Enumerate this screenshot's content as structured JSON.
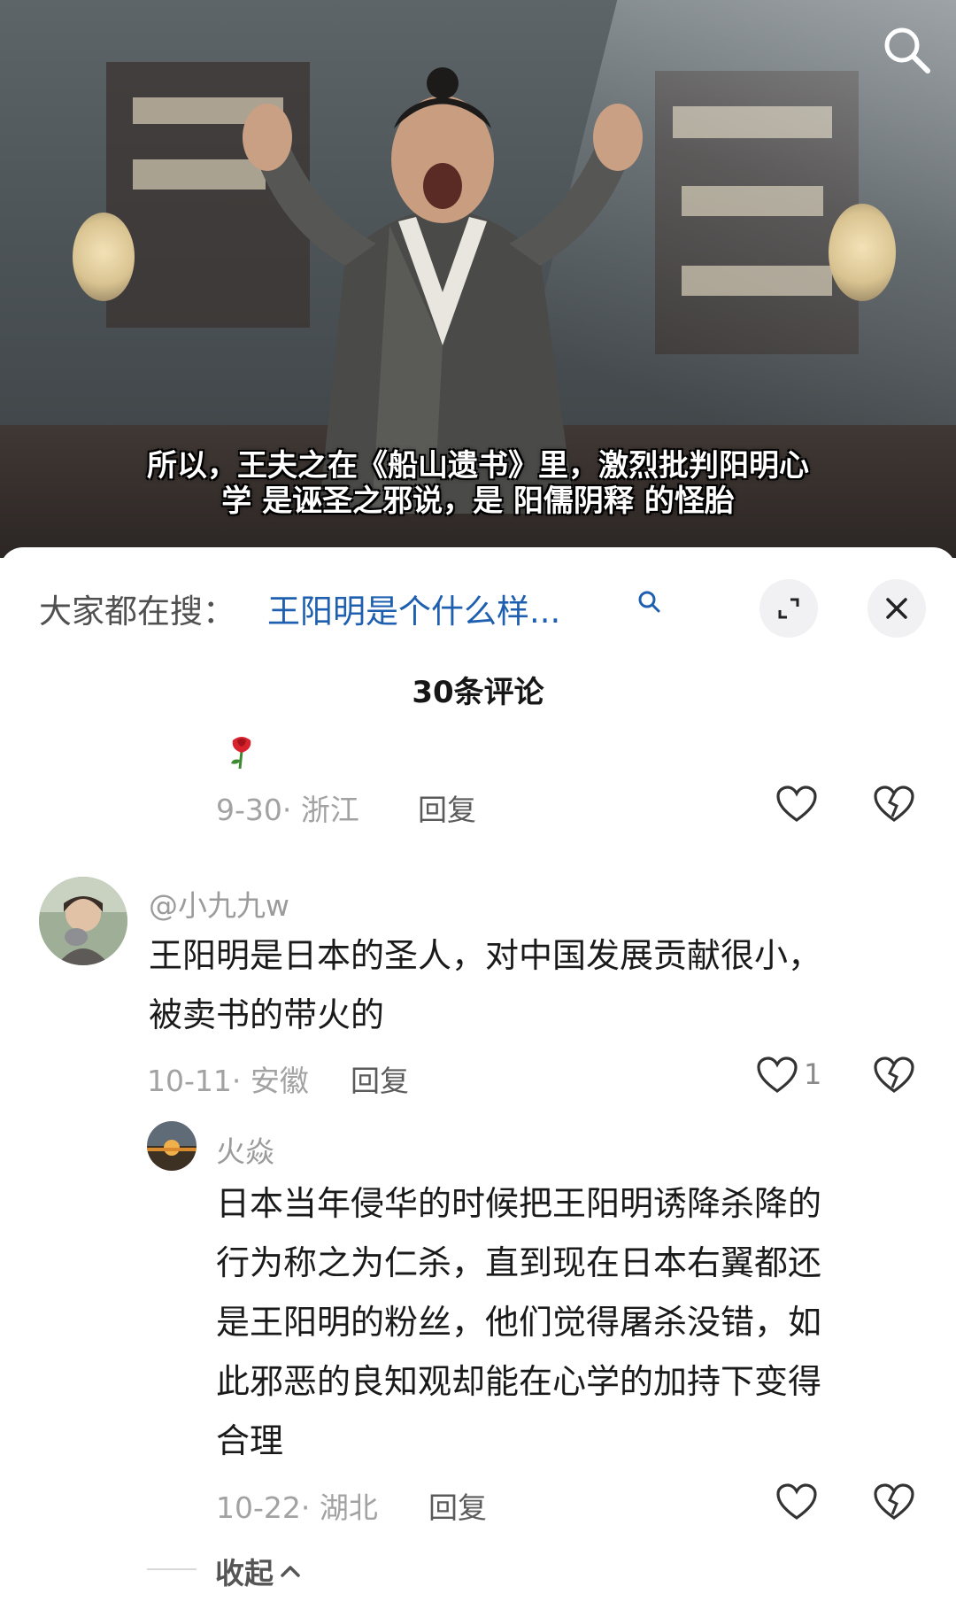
{
  "video": {
    "subtitle_line1": "所以，王夫之在《船山遗书》里，激烈批判阳明心",
    "subtitle_line2": "学 是诬圣之邪说，是 阳儒阴释 的怪胎",
    "search_icon": "search-icon"
  },
  "sheet": {
    "hot_search_label": "大家都在搜：",
    "hot_search_query": "王阳明是个什么样...",
    "comment_count_title": "30条评论",
    "icons": {
      "expand": "expand-icon",
      "close": "close-icon",
      "search": "search-icon"
    }
  },
  "comments": [
    {
      "emoji": "rose",
      "date_location": "9-30· 浙江",
      "reply_label": "回复"
    },
    {
      "username": "@小九九w",
      "text_line1": "王阳明是日本的圣人，对中国发展贡献很小，",
      "text_line2": "被卖书的带火的",
      "date_location": "10-11· 安徽",
      "reply_label": "回复",
      "like_count": "1"
    },
    {
      "username": "火焱",
      "text_lines": [
        "日本当年侵华的时候把王阳明诱降杀降的",
        "行为称之为仁杀，直到现在日本右翼都还",
        "是王阳明的粉丝，他们觉得屠杀没错，如",
        "此邪恶的良知观却能在心学的加持下变得",
        "合理"
      ],
      "date_location": "10-22· 湖北",
      "reply_label": "回复"
    }
  ],
  "collapse_label": "收起"
}
